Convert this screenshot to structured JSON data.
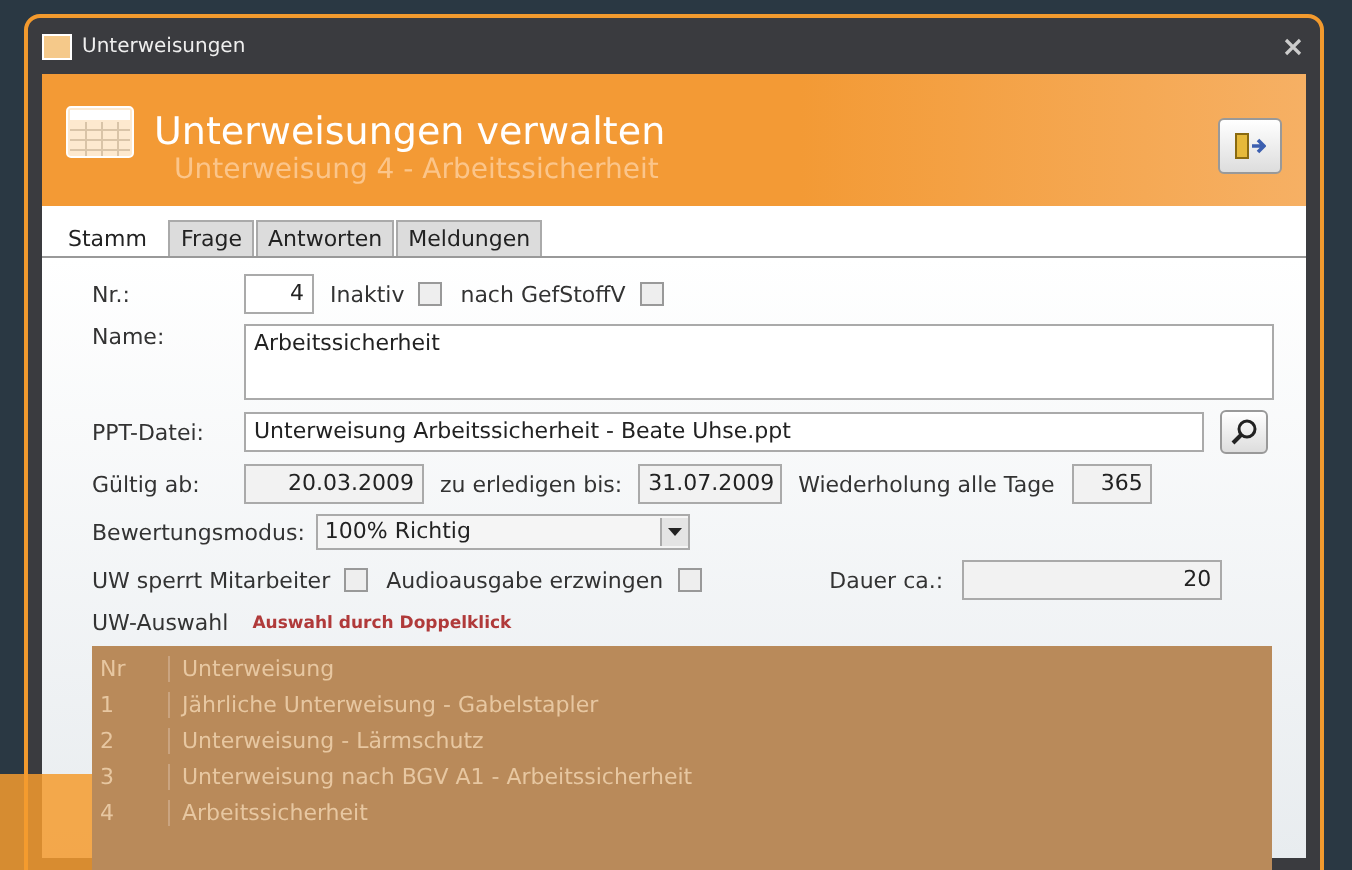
{
  "window": {
    "title": "Unterweisungen"
  },
  "header": {
    "title": "Unterweisungen verwalten",
    "subtitle": "Unterweisung 4 - Arbeitssicherheit"
  },
  "tabs": [
    {
      "label": "Stamm",
      "selected": true
    },
    {
      "label": "Frage",
      "selected": false
    },
    {
      "label": "Antworten",
      "selected": false
    },
    {
      "label": "Meldungen",
      "selected": false
    }
  ],
  "form": {
    "nr_label": "Nr.:",
    "nr": "4",
    "inaktiv_label": "Inaktiv",
    "inaktiv": false,
    "gefstoff_label": "nach GefStoffV",
    "gefstoff": false,
    "name_label": "Name:",
    "name": "Arbeitssicherheit",
    "ppt_label": "PPT-Datei:",
    "ppt": "Unterweisung Arbeitssicherheit - Beate Uhse.ppt",
    "gueltig_label": "Gültig ab:",
    "gueltig": "20.03.2009",
    "erledigen_label": "zu erledigen bis:",
    "erledigen": "31.07.2009",
    "wiederholung_label": "Wiederholung alle Tage",
    "wiederholung": "365",
    "bewertung_label": "Bewertungsmodus:",
    "bewertung": "100% Richtig",
    "sperrt_label": "UW sperrt Mitarbeiter",
    "sperrt": false,
    "audio_label": "Audioausgabe erzwingen",
    "audio": false,
    "dauer_label": "Dauer ca.:",
    "dauer": "20"
  },
  "selection": {
    "label": "UW-Auswahl",
    "hint": "Auswahl durch Doppelklick",
    "columns": [
      "Nr",
      "Unterweisung"
    ],
    "rows": [
      [
        "1",
        "Jährliche Unterweisung - Gabelstapler"
      ],
      [
        "2",
        "Unterweisung - Lärmschutz"
      ],
      [
        "3",
        "Unterweisung nach BGV A1 - Arbeitssicherheit"
      ],
      [
        "4",
        "Arbeitssicherheit"
      ]
    ]
  }
}
